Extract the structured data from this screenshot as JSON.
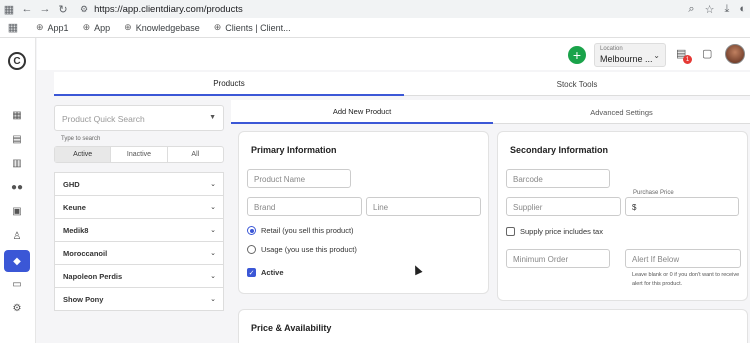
{
  "browser": {
    "url": "https://app.clientdiary.com/products",
    "bookmarks": [
      "App1",
      "App",
      "Knowledgebase",
      "Clients | Client..."
    ]
  },
  "header": {
    "location_label": "Location",
    "location_value": "Melbourne ...",
    "notification_count": "1"
  },
  "tabs": [
    "Products",
    "Stock Tools"
  ],
  "search": {
    "placeholder": "Product Quick Search",
    "hint": "Type to search"
  },
  "filter": [
    "Active",
    "Inactive",
    "All"
  ],
  "brands": [
    "GHD",
    "Keune",
    "Medik8",
    "Moroccanoil",
    "Napoleon Perdis",
    "Show Pony"
  ],
  "subtabs": [
    "Add New Product",
    "Advanced Settings"
  ],
  "primary": {
    "title": "Primary Information",
    "product_name": "Product Name",
    "brand": "Brand",
    "line": "Line",
    "retail": "Retail (you sell this product)",
    "usage": "Usage (you use this product)",
    "active": "Active"
  },
  "secondary": {
    "title": "Secondary Information",
    "barcode": "Barcode",
    "supplier": "Supplier",
    "purchase_price_label": "Purchase Price",
    "purchase_price_prefix": "$",
    "tax": "Supply price includes tax",
    "min_order": "Minimum Order",
    "alert": "Alert If Below",
    "alert_note": "Leave blank or 0 if you don't want to receive alert for this product."
  },
  "price": {
    "title": "Price & Availability"
  },
  "colors": {
    "accent": "#3b57d6",
    "add": "#1aa34a",
    "badge": "#e53935"
  }
}
